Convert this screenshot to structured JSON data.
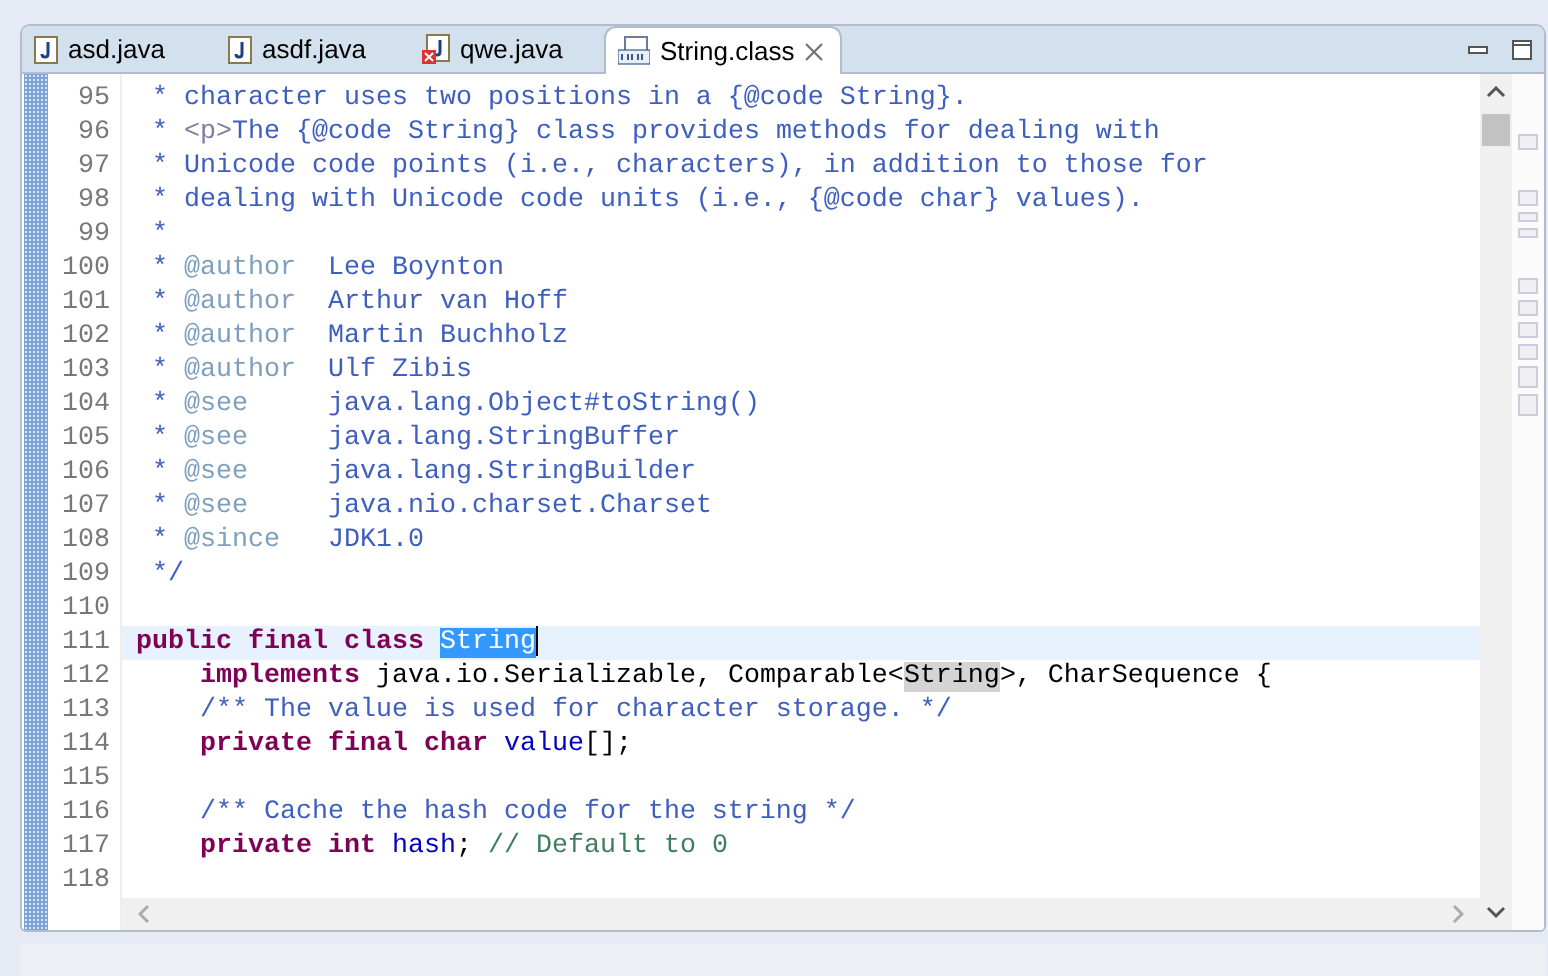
{
  "tabs": [
    {
      "label": "asd.java",
      "kind": "java",
      "selected": false
    },
    {
      "label": "asdf.java",
      "kind": "java",
      "selected": false
    },
    {
      "label": "qwe.java",
      "kind": "java_error",
      "selected": false
    },
    {
      "label": "String.class",
      "kind": "class",
      "selected": true
    }
  ],
  "lines": [
    {
      "number": "95",
      "current": false,
      "tokens": [
        {
          "text": " * character uses two positions in a {@code String}.",
          "kind": "comment"
        }
      ]
    },
    {
      "number": "96",
      "current": false,
      "tokens": [
        {
          "text": " * ",
          "kind": "comment"
        },
        {
          "text": "<p>",
          "kind": "html_tag"
        },
        {
          "text": "The {@code String} class provides methods for dealing with",
          "kind": "comment"
        }
      ]
    },
    {
      "number": "97",
      "current": false,
      "tokens": [
        {
          "text": " * Unicode code points (i.e., characters), in addition to those for",
          "kind": "comment"
        }
      ]
    },
    {
      "number": "98",
      "current": false,
      "tokens": [
        {
          "text": " * dealing with Unicode code units (i.e., {@code char} values).",
          "kind": "comment"
        }
      ]
    },
    {
      "number": "99",
      "current": false,
      "tokens": [
        {
          "text": " *",
          "kind": "comment"
        }
      ]
    },
    {
      "number": "100",
      "current": false,
      "tokens": [
        {
          "text": " * ",
          "kind": "comment"
        },
        {
          "text": "@author",
          "kind": "doc_tag"
        },
        {
          "text": "  Lee Boynton",
          "kind": "comment"
        }
      ]
    },
    {
      "number": "101",
      "current": false,
      "tokens": [
        {
          "text": " * ",
          "kind": "comment"
        },
        {
          "text": "@author",
          "kind": "doc_tag"
        },
        {
          "text": "  Arthur van Hoff",
          "kind": "comment"
        }
      ]
    },
    {
      "number": "102",
      "current": false,
      "tokens": [
        {
          "text": " * ",
          "kind": "comment"
        },
        {
          "text": "@author",
          "kind": "doc_tag"
        },
        {
          "text": "  Martin Buchholz",
          "kind": "comment"
        }
      ]
    },
    {
      "number": "103",
      "current": false,
      "tokens": [
        {
          "text": " * ",
          "kind": "comment"
        },
        {
          "text": "@author",
          "kind": "doc_tag"
        },
        {
          "text": "  Ulf Zibis",
          "kind": "comment"
        }
      ]
    },
    {
      "number": "104",
      "current": false,
      "tokens": [
        {
          "text": " * ",
          "kind": "comment"
        },
        {
          "text": "@see",
          "kind": "doc_tag"
        },
        {
          "text": "     java.lang.Object#toString()",
          "kind": "comment"
        }
      ]
    },
    {
      "number": "105",
      "current": false,
      "tokens": [
        {
          "text": " * ",
          "kind": "comment"
        },
        {
          "text": "@see",
          "kind": "doc_tag"
        },
        {
          "text": "     java.lang.StringBuffer",
          "kind": "comment"
        }
      ]
    },
    {
      "number": "106",
      "current": false,
      "tokens": [
        {
          "text": " * ",
          "kind": "comment"
        },
        {
          "text": "@see",
          "kind": "doc_tag"
        },
        {
          "text": "     java.lang.StringBuilder",
          "kind": "comment"
        }
      ]
    },
    {
      "number": "107",
      "current": false,
      "tokens": [
        {
          "text": " * ",
          "kind": "comment"
        },
        {
          "text": "@see",
          "kind": "doc_tag"
        },
        {
          "text": "     java.nio.charset.Charset",
          "kind": "comment"
        }
      ]
    },
    {
      "number": "108",
      "current": false,
      "tokens": [
        {
          "text": " * ",
          "kind": "comment"
        },
        {
          "text": "@since",
          "kind": "doc_tag"
        },
        {
          "text": "   JDK1.0",
          "kind": "comment"
        }
      ]
    },
    {
      "number": "109",
      "current": false,
      "tokens": [
        {
          "text": " */",
          "kind": "comment"
        }
      ]
    },
    {
      "number": "110",
      "current": false
    },
    {
      "number": "111",
      "current": true,
      "tokens": [
        {
          "text": "public final class ",
          "kind": "keyword"
        },
        {
          "text": "String",
          "kind": "selection"
        }
      ]
    },
    {
      "number": "112",
      "current": false,
      "tokens": [
        {
          "text": "    implements",
          "kind": "keyword"
        },
        {
          "text": " java.io.Serializable, Comparable<",
          "kind": "code"
        },
        {
          "text": "String",
          "kind": "occurrence"
        },
        {
          "text": ">, CharSequence {",
          "kind": "code"
        }
      ]
    },
    {
      "number": "113",
      "current": false,
      "tokens": [
        {
          "text": "    /** The value is used for character storage. */",
          "kind": "comment"
        }
      ]
    },
    {
      "number": "114",
      "current": false,
      "tokens": [
        {
          "text": "    private final char",
          "kind": "keyword"
        },
        {
          "text": " value",
          "kind": "field"
        },
        {
          "text": "[];",
          "kind": "code"
        }
      ]
    },
    {
      "number": "115",
      "current": false
    },
    {
      "number": "116",
      "current": false,
      "tokens": [
        {
          "text": "    /** Cache the hash code for the string */",
          "kind": "comment"
        }
      ]
    },
    {
      "number": "117",
      "current": false,
      "tokens": [
        {
          "text": "    private int",
          "kind": "keyword"
        },
        {
          "text": " hash",
          "kind": "field"
        },
        {
          "text": ";",
          "kind": "code"
        },
        {
          "text": " // Default to 0",
          "kind": "line_comment"
        }
      ]
    },
    {
      "number": "118",
      "current": false
    }
  ]
}
